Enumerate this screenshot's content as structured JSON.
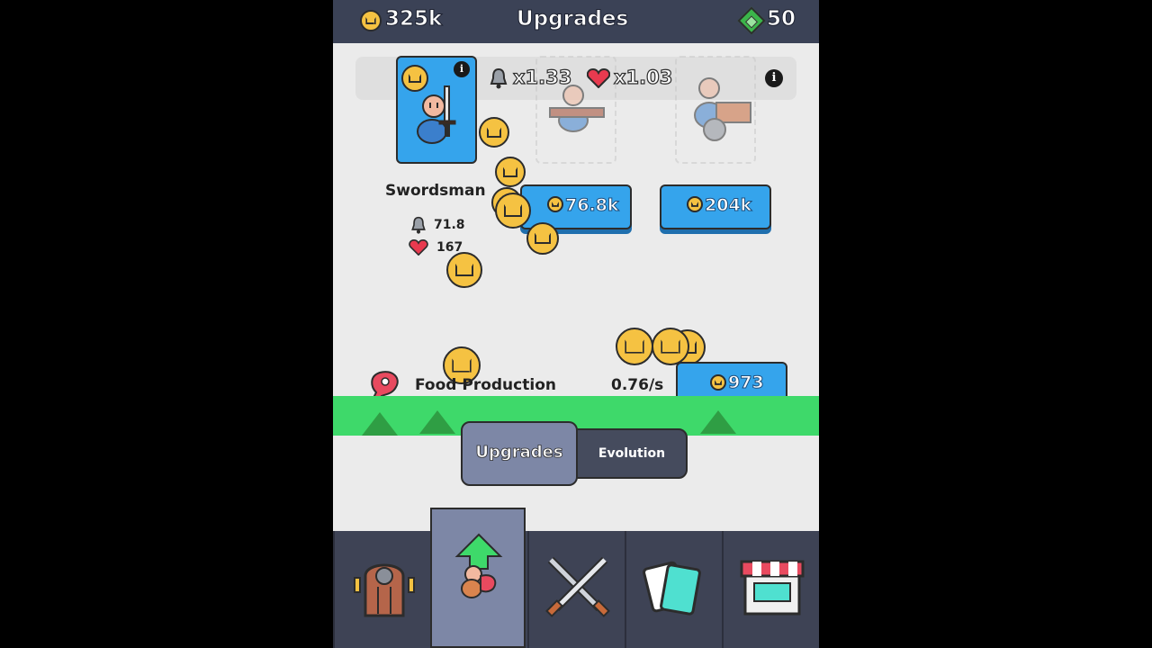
{
  "header": {
    "coins": "325k",
    "title": "Upgrades",
    "gems": "50"
  },
  "unit_bar": {
    "attack_mult": "x1.33",
    "health_mult": "x1.03"
  },
  "units": [
    {
      "name": "Swordsman",
      "attack": "71.8",
      "health": "167",
      "state": "owned"
    },
    {
      "name": "",
      "price": "76.8k",
      "state": "locked"
    },
    {
      "name": "",
      "price": "204k",
      "state": "locked"
    }
  ],
  "food": {
    "label": "Food Production",
    "rate": "0.76/s",
    "price": "973"
  },
  "tabs": {
    "upgrades": "Upgrades",
    "evolution": "Evolution"
  },
  "nav": [
    {
      "icon": "door-icon"
    },
    {
      "icon": "upgrade-arrow-icon",
      "selected": true
    },
    {
      "icon": "crossed-swords-icon"
    },
    {
      "icon": "cards-icon"
    },
    {
      "icon": "shop-icon"
    }
  ],
  "colors": {
    "topbar": "#3b4256",
    "button": "#35a4ec",
    "coin": "#f5c242",
    "gem": "#3bb54a",
    "grass": "#3ed96a",
    "nav": "#3e4355",
    "nav_selected": "#7d87a6"
  }
}
